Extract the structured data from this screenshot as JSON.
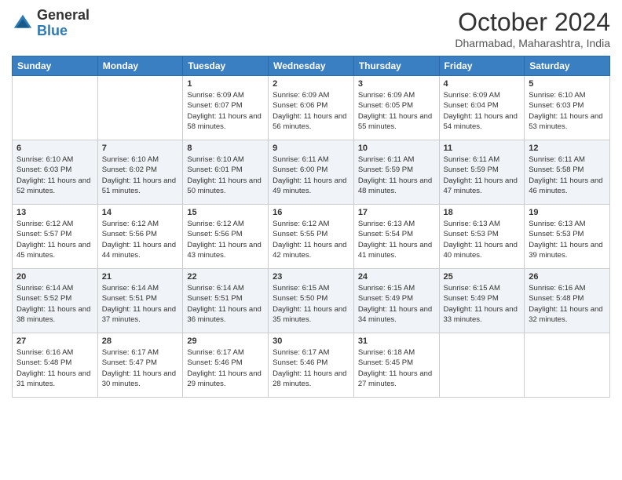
{
  "header": {
    "logo": {
      "general": "General",
      "blue": "Blue"
    },
    "month": "October 2024",
    "location": "Dharmabad, Maharashtra, India"
  },
  "weekdays": [
    "Sunday",
    "Monday",
    "Tuesday",
    "Wednesday",
    "Thursday",
    "Friday",
    "Saturday"
  ],
  "weeks": [
    [
      {
        "day": "",
        "sunrise": "",
        "sunset": "",
        "daylight": ""
      },
      {
        "day": "",
        "sunrise": "",
        "sunset": "",
        "daylight": ""
      },
      {
        "day": "1",
        "sunrise": "Sunrise: 6:09 AM",
        "sunset": "Sunset: 6:07 PM",
        "daylight": "Daylight: 11 hours and 58 minutes."
      },
      {
        "day": "2",
        "sunrise": "Sunrise: 6:09 AM",
        "sunset": "Sunset: 6:06 PM",
        "daylight": "Daylight: 11 hours and 56 minutes."
      },
      {
        "day": "3",
        "sunrise": "Sunrise: 6:09 AM",
        "sunset": "Sunset: 6:05 PM",
        "daylight": "Daylight: 11 hours and 55 minutes."
      },
      {
        "day": "4",
        "sunrise": "Sunrise: 6:09 AM",
        "sunset": "Sunset: 6:04 PM",
        "daylight": "Daylight: 11 hours and 54 minutes."
      },
      {
        "day": "5",
        "sunrise": "Sunrise: 6:10 AM",
        "sunset": "Sunset: 6:03 PM",
        "daylight": "Daylight: 11 hours and 53 minutes."
      }
    ],
    [
      {
        "day": "6",
        "sunrise": "Sunrise: 6:10 AM",
        "sunset": "Sunset: 6:03 PM",
        "daylight": "Daylight: 11 hours and 52 minutes."
      },
      {
        "day": "7",
        "sunrise": "Sunrise: 6:10 AM",
        "sunset": "Sunset: 6:02 PM",
        "daylight": "Daylight: 11 hours and 51 minutes."
      },
      {
        "day": "8",
        "sunrise": "Sunrise: 6:10 AM",
        "sunset": "Sunset: 6:01 PM",
        "daylight": "Daylight: 11 hours and 50 minutes."
      },
      {
        "day": "9",
        "sunrise": "Sunrise: 6:11 AM",
        "sunset": "Sunset: 6:00 PM",
        "daylight": "Daylight: 11 hours and 49 minutes."
      },
      {
        "day": "10",
        "sunrise": "Sunrise: 6:11 AM",
        "sunset": "Sunset: 5:59 PM",
        "daylight": "Daylight: 11 hours and 48 minutes."
      },
      {
        "day": "11",
        "sunrise": "Sunrise: 6:11 AM",
        "sunset": "Sunset: 5:59 PM",
        "daylight": "Daylight: 11 hours and 47 minutes."
      },
      {
        "day": "12",
        "sunrise": "Sunrise: 6:11 AM",
        "sunset": "Sunset: 5:58 PM",
        "daylight": "Daylight: 11 hours and 46 minutes."
      }
    ],
    [
      {
        "day": "13",
        "sunrise": "Sunrise: 6:12 AM",
        "sunset": "Sunset: 5:57 PM",
        "daylight": "Daylight: 11 hours and 45 minutes."
      },
      {
        "day": "14",
        "sunrise": "Sunrise: 6:12 AM",
        "sunset": "Sunset: 5:56 PM",
        "daylight": "Daylight: 11 hours and 44 minutes."
      },
      {
        "day": "15",
        "sunrise": "Sunrise: 6:12 AM",
        "sunset": "Sunset: 5:56 PM",
        "daylight": "Daylight: 11 hours and 43 minutes."
      },
      {
        "day": "16",
        "sunrise": "Sunrise: 6:12 AM",
        "sunset": "Sunset: 5:55 PM",
        "daylight": "Daylight: 11 hours and 42 minutes."
      },
      {
        "day": "17",
        "sunrise": "Sunrise: 6:13 AM",
        "sunset": "Sunset: 5:54 PM",
        "daylight": "Daylight: 11 hours and 41 minutes."
      },
      {
        "day": "18",
        "sunrise": "Sunrise: 6:13 AM",
        "sunset": "Sunset: 5:53 PM",
        "daylight": "Daylight: 11 hours and 40 minutes."
      },
      {
        "day": "19",
        "sunrise": "Sunrise: 6:13 AM",
        "sunset": "Sunset: 5:53 PM",
        "daylight": "Daylight: 11 hours and 39 minutes."
      }
    ],
    [
      {
        "day": "20",
        "sunrise": "Sunrise: 6:14 AM",
        "sunset": "Sunset: 5:52 PM",
        "daylight": "Daylight: 11 hours and 38 minutes."
      },
      {
        "day": "21",
        "sunrise": "Sunrise: 6:14 AM",
        "sunset": "Sunset: 5:51 PM",
        "daylight": "Daylight: 11 hours and 37 minutes."
      },
      {
        "day": "22",
        "sunrise": "Sunrise: 6:14 AM",
        "sunset": "Sunset: 5:51 PM",
        "daylight": "Daylight: 11 hours and 36 minutes."
      },
      {
        "day": "23",
        "sunrise": "Sunrise: 6:15 AM",
        "sunset": "Sunset: 5:50 PM",
        "daylight": "Daylight: 11 hours and 35 minutes."
      },
      {
        "day": "24",
        "sunrise": "Sunrise: 6:15 AM",
        "sunset": "Sunset: 5:49 PM",
        "daylight": "Daylight: 11 hours and 34 minutes."
      },
      {
        "day": "25",
        "sunrise": "Sunrise: 6:15 AM",
        "sunset": "Sunset: 5:49 PM",
        "daylight": "Daylight: 11 hours and 33 minutes."
      },
      {
        "day": "26",
        "sunrise": "Sunrise: 6:16 AM",
        "sunset": "Sunset: 5:48 PM",
        "daylight": "Daylight: 11 hours and 32 minutes."
      }
    ],
    [
      {
        "day": "27",
        "sunrise": "Sunrise: 6:16 AM",
        "sunset": "Sunset: 5:48 PM",
        "daylight": "Daylight: 11 hours and 31 minutes."
      },
      {
        "day": "28",
        "sunrise": "Sunrise: 6:17 AM",
        "sunset": "Sunset: 5:47 PM",
        "daylight": "Daylight: 11 hours and 30 minutes."
      },
      {
        "day": "29",
        "sunrise": "Sunrise: 6:17 AM",
        "sunset": "Sunset: 5:46 PM",
        "daylight": "Daylight: 11 hours and 29 minutes."
      },
      {
        "day": "30",
        "sunrise": "Sunrise: 6:17 AM",
        "sunset": "Sunset: 5:46 PM",
        "daylight": "Daylight: 11 hours and 28 minutes."
      },
      {
        "day": "31",
        "sunrise": "Sunrise: 6:18 AM",
        "sunset": "Sunset: 5:45 PM",
        "daylight": "Daylight: 11 hours and 27 minutes."
      },
      {
        "day": "",
        "sunrise": "",
        "sunset": "",
        "daylight": ""
      },
      {
        "day": "",
        "sunrise": "",
        "sunset": "",
        "daylight": ""
      }
    ]
  ]
}
